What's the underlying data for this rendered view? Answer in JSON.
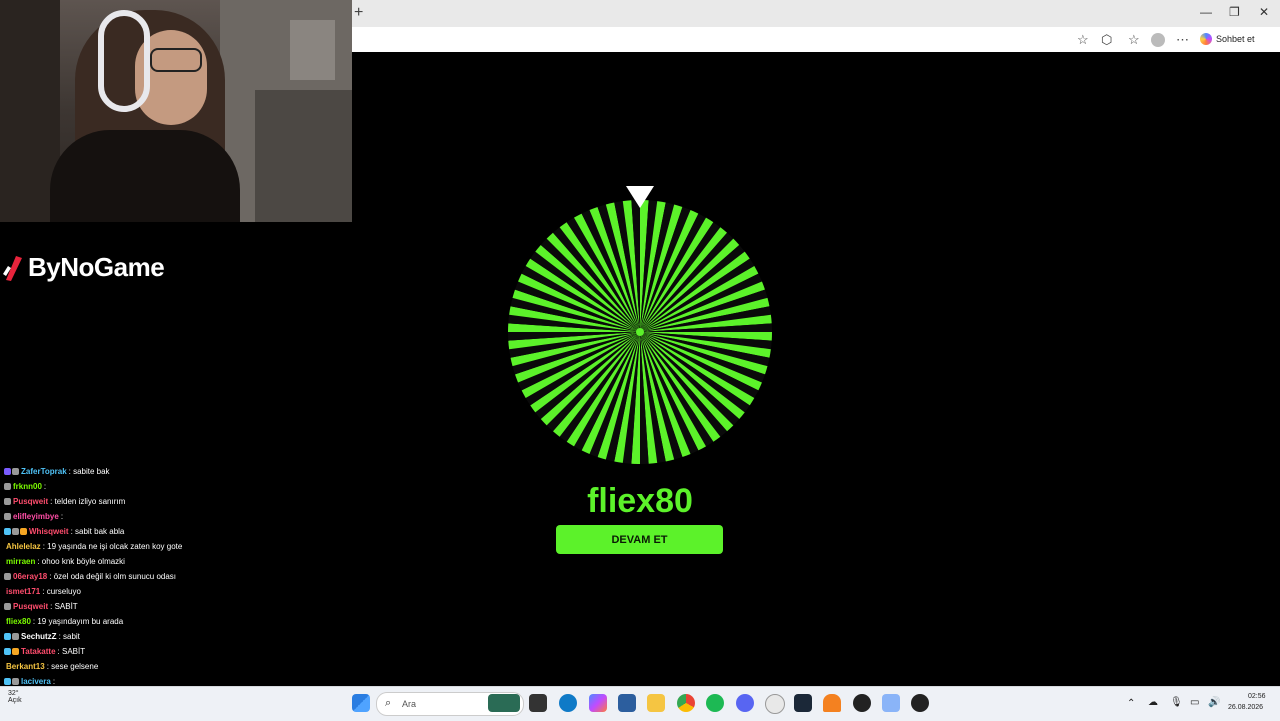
{
  "browser": {
    "new_tab_glyph": "+",
    "sohbet_label": "Sohbet et",
    "win_min": "—",
    "win_max": "❐",
    "win_close": "✕"
  },
  "brand": {
    "name": "ByNoGame"
  },
  "wheel": {
    "winner": "fliex80",
    "button_label": "DEVAM ET",
    "segment_count": 96,
    "colors": {
      "green": "#5cf22a",
      "dark": "#0a0a0a"
    }
  },
  "chat": [
    {
      "user": "ZaferToprak",
      "color": "#4fc3f7",
      "msg": " : sabite bak",
      "badges": [
        "#7a5cff",
        "#999"
      ]
    },
    {
      "user": "frknn00",
      "color": "#7cfc00",
      "msg": " : ",
      "badges": [
        "#999"
      ]
    },
    {
      "user": "Pusqweit",
      "color": "#ff4d6d",
      "msg": " : telden izliyo sanırım",
      "badges": [
        "#999"
      ]
    },
    {
      "user": "elifleyimbye",
      "color": "#ff4da6",
      "msg": " : ",
      "badges": [
        "#999"
      ]
    },
    {
      "user": "Whisqweit",
      "color": "#ff4d6d",
      "msg": " : sabit bak abla",
      "badges": [
        "#4fc3f7",
        "#999",
        "#f5a623"
      ]
    },
    {
      "user": "Ahlelelaz",
      "color": "#f5c542",
      "msg": " : 19 yaşında ne işi olcak zaten koy gote",
      "badges": []
    },
    {
      "user": "mirraen",
      "color": "#7cfc00",
      "msg": " : ohoo knk böyle olmazki",
      "badges": []
    },
    {
      "user": "06eray18",
      "color": "#ff4d6d",
      "msg": " : özel oda değil ki olm sunucu odası",
      "badges": [
        "#999"
      ]
    },
    {
      "user": "ismet171",
      "color": "#ff4d6d",
      "msg": " : curseluyo",
      "badges": []
    },
    {
      "user": "Pusqweit",
      "color": "#ff4d6d",
      "msg": " : SABİT",
      "badges": [
        "#999"
      ]
    },
    {
      "user": "fliex80",
      "color": "#7cfc00",
      "msg": " : 19 yaşındayım bu arada",
      "badges": []
    },
    {
      "user": "SechutzZ",
      "color": "#ffffff",
      "msg": " : sabit",
      "badges": [
        "#4fc3f7",
        "#999"
      ]
    },
    {
      "user": "Tatakatte",
      "color": "#ff4d6d",
      "msg": " : SABİT",
      "badges": [
        "#4fc3f7",
        "#f5a623"
      ]
    },
    {
      "user": "Berkant13",
      "color": "#f5c542",
      "msg": " : sese gelsene",
      "badges": []
    },
    {
      "user": "lacivera",
      "color": "#4fc3f7",
      "msg": " : ",
      "badges": [
        "#4fc3f7",
        "#999"
      ]
    }
  ],
  "taskbar": {
    "search_placeholder": "Ara",
    "time": "02:56",
    "date": "26.08.2026",
    "weather_label": "Açık",
    "weather_temp": "32°"
  }
}
